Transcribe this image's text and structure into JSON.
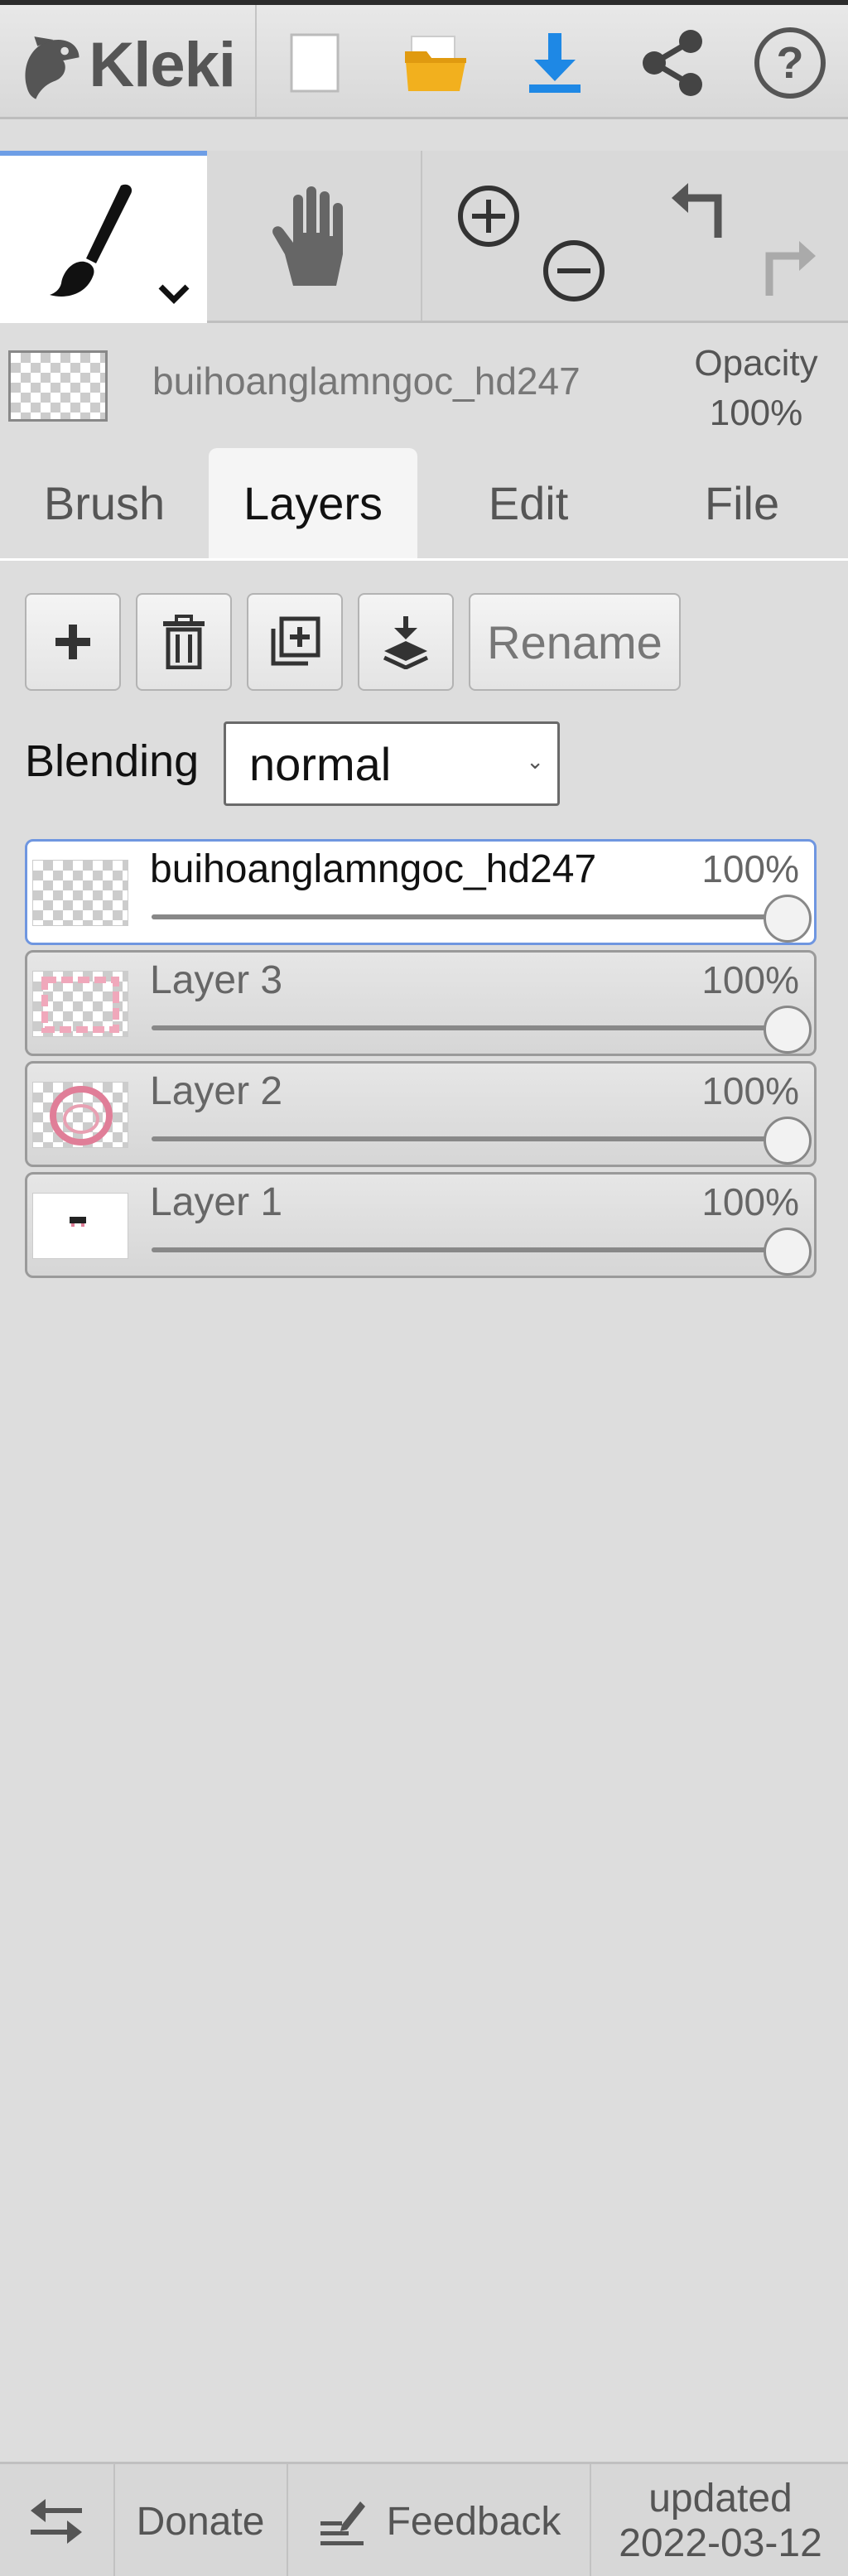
{
  "app": {
    "name": "Kleki"
  },
  "header": {
    "buttons": [
      {
        "icon": "new-document-icon"
      },
      {
        "icon": "open-folder-icon"
      },
      {
        "icon": "download-icon"
      },
      {
        "icon": "share-icon"
      },
      {
        "icon": "help-icon"
      }
    ],
    "accent_color": "#1e88e5"
  },
  "tools": {
    "items": [
      {
        "icon": "brush-icon",
        "selected": true
      },
      {
        "icon": "hand-icon"
      },
      {
        "icon": "zoom-in-icon"
      },
      {
        "icon": "zoom-out-icon"
      },
      {
        "icon": "undo-icon"
      },
      {
        "icon": "redo-icon"
      }
    ]
  },
  "current_layer": {
    "name": "buihoanglamngoc_hd247",
    "opacity_label": "Opacity",
    "opacity_value": "100%"
  },
  "tabs": [
    {
      "label": "Brush"
    },
    {
      "label": "Layers",
      "active": true
    },
    {
      "label": "Edit"
    },
    {
      "label": "File"
    }
  ],
  "layer_actions": {
    "rename_label": "Rename",
    "icons": [
      "add-layer-icon",
      "delete-layer-icon",
      "duplicate-layer-icon",
      "merge-down-icon"
    ]
  },
  "blending": {
    "label": "Blending",
    "value": "normal"
  },
  "layers": [
    {
      "name": "buihoanglamngoc_hd247",
      "opacity": "100%",
      "opacity_fraction": 1.0,
      "active": true
    },
    {
      "name": "Layer 3",
      "opacity": "100%",
      "opacity_fraction": 1.0
    },
    {
      "name": "Layer 2",
      "opacity": "100%",
      "opacity_fraction": 1.0
    },
    {
      "name": "Layer 1",
      "opacity": "100%",
      "opacity_fraction": 1.0
    }
  ],
  "footer": {
    "donate": "Donate",
    "feedback": "Feedback",
    "updated_label": "updated",
    "updated_date": "2022-03-12"
  }
}
